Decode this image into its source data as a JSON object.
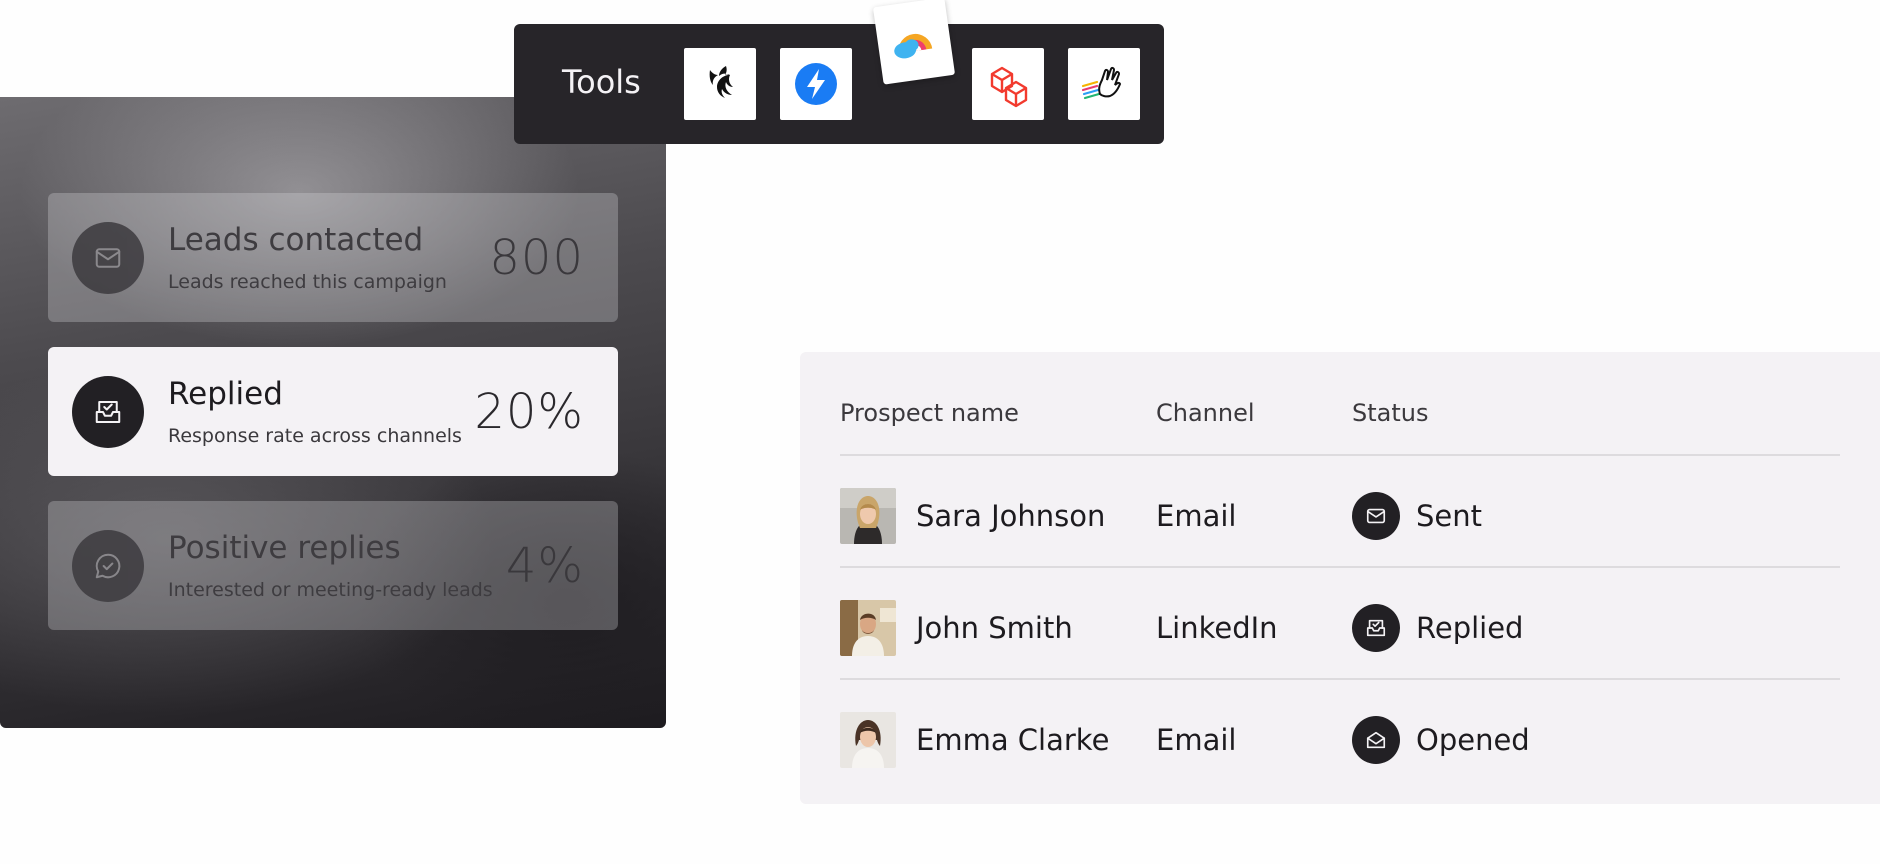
{
  "tools": {
    "label": "Tools",
    "items": [
      {
        "icon": "bird-logo-icon"
      },
      {
        "icon": "lightning-bolt-icon",
        "color": "#1a7cf4"
      },
      {
        "icon": "rainbow-cloud-icon"
      },
      {
        "icon": "cubes-icon",
        "color": "#f23a2e"
      },
      {
        "icon": "waving-hand-icon"
      }
    ]
  },
  "stats": [
    {
      "title": "Leads contacted",
      "subtitle": "Leads reached this campaign",
      "value": "800",
      "icon": "mail-icon",
      "active": false
    },
    {
      "title": "Replied",
      "subtitle": "Response rate across channels",
      "value": "20%",
      "icon": "inbox-check-icon",
      "active": true
    },
    {
      "title": "Positive replies",
      "subtitle": "Interested or meeting-ready leads",
      "value": "4%",
      "icon": "chat-check-icon",
      "active": false
    }
  ],
  "table": {
    "headers": {
      "name": "Prospect name",
      "channel": "Channel",
      "status": "Status"
    },
    "rows": [
      {
        "name": "Sara Johnson",
        "channel": "Email",
        "status": "Sent",
        "status_icon": "mail-icon"
      },
      {
        "name": "John Smith",
        "channel": "LinkedIn",
        "status": "Replied",
        "status_icon": "inbox-check-icon"
      },
      {
        "name": "Emma Clarke",
        "channel": "Email",
        "status": "Opened",
        "status_icon": "open-mail-icon"
      }
    ]
  },
  "colors": {
    "panel_dark": "#272529",
    "card_active": "#f4f2f5",
    "table_bg": "#f4f2f5",
    "icon_circle": "#222024"
  }
}
